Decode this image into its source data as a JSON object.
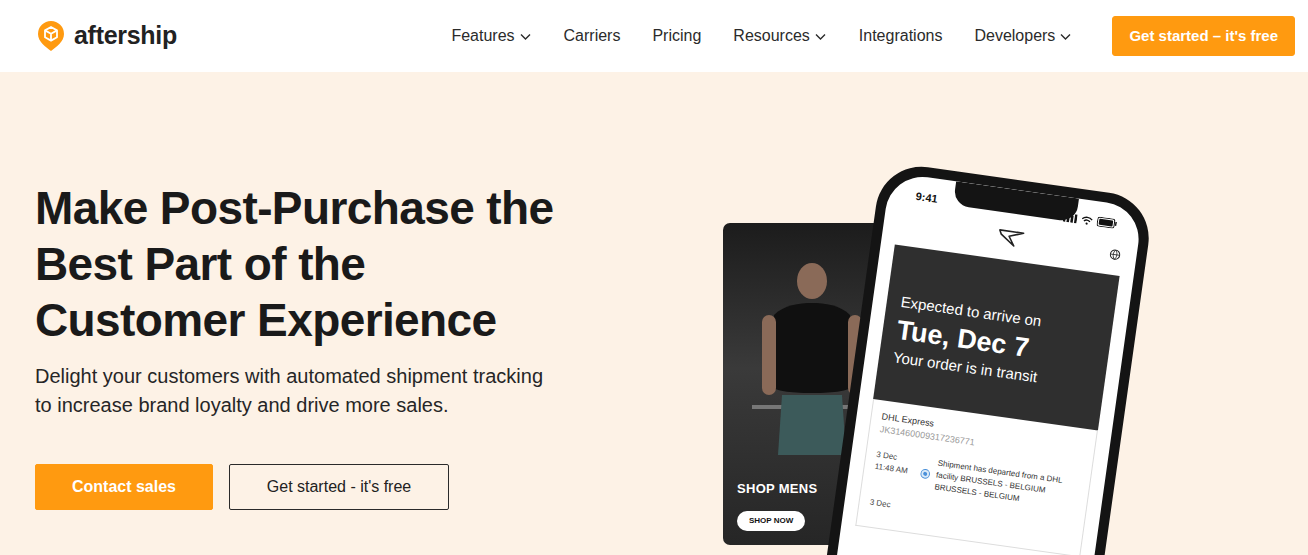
{
  "logo": {
    "text": "aftership"
  },
  "nav": {
    "items": [
      {
        "label": "Features",
        "dropdown": true
      },
      {
        "label": "Carriers",
        "dropdown": false
      },
      {
        "label": "Pricing",
        "dropdown": false
      },
      {
        "label": "Resources",
        "dropdown": true
      },
      {
        "label": "Integrations",
        "dropdown": false
      },
      {
        "label": "Developers",
        "dropdown": true
      }
    ],
    "cta": "Get started – it's free"
  },
  "hero": {
    "title_lines": [
      "Make Post-Purchase the",
      "Best Part of the",
      "Customer Experience"
    ],
    "subtitle_lines": [
      "Delight your customers with automated shipment tracking",
      "to increase brand loyalty and drive more sales."
    ],
    "buttons": [
      {
        "label": "Contact sales",
        "kind": "primary"
      },
      {
        "label": "Get started - it's free",
        "kind": "outline"
      }
    ]
  },
  "promo_card": {
    "title": "SHOP MENS",
    "button": "SHOP NOW"
  },
  "phone": {
    "time": "9:41",
    "status_card": {
      "eyebrow": "Expected to arrive on",
      "date": "Tue, Dec 7",
      "status": "Your order is in transit"
    },
    "carrier": "DHL Express",
    "tracking_number": "JK31460009317236771",
    "events": [
      {
        "date": "3 Dec",
        "time": "11:48 AM",
        "message": "Shipment has departed from a DHL facility BRUSSELS - BELGIUM",
        "location": "BRUSSELS - BELGIUM"
      },
      {
        "date": "3 Dec"
      }
    ]
  }
}
